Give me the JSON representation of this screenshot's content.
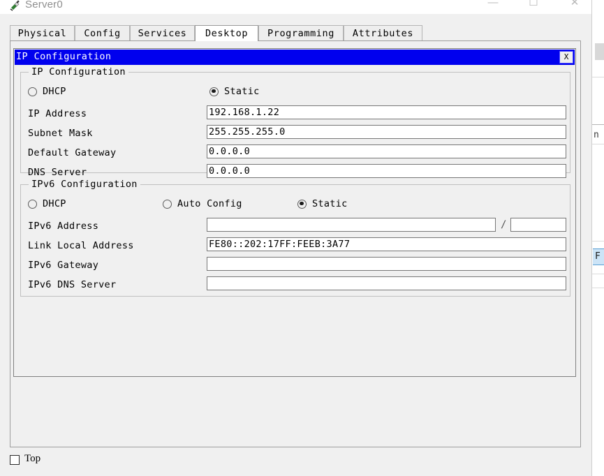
{
  "window": {
    "title": "Server0",
    "icon": "device-server-icon",
    "controls": {
      "minimize": "—",
      "maximize": "☐",
      "close": "✕"
    }
  },
  "tabs": [
    {
      "label": "Physical",
      "active": false
    },
    {
      "label": "Config",
      "active": false
    },
    {
      "label": "Services",
      "active": false
    },
    {
      "label": "Desktop",
      "active": true
    },
    {
      "label": "Programming",
      "active": false
    },
    {
      "label": "Attributes",
      "active": false
    }
  ],
  "dialog": {
    "title": "IP Configuration",
    "close_label": "X",
    "ipv4": {
      "legend": "IP Configuration",
      "mode_options": [
        {
          "label": "DHCP",
          "selected": false
        },
        {
          "label": "Static",
          "selected": true
        }
      ],
      "fields": [
        {
          "label": "IP Address",
          "value": "192.168.1.22"
        },
        {
          "label": "Subnet Mask",
          "value": "255.255.255.0"
        },
        {
          "label": "Default Gateway",
          "value": "0.0.0.0"
        },
        {
          "label": "DNS Server",
          "value": "0.0.0.0"
        }
      ]
    },
    "ipv6": {
      "legend": "IPv6 Configuration",
      "mode_options": [
        {
          "label": "DHCP",
          "selected": false
        },
        {
          "label": "Auto Config",
          "selected": false
        },
        {
          "label": "Static",
          "selected": true
        }
      ],
      "prefix_separator": "/",
      "prefix_value": "",
      "fields": [
        {
          "label": "IPv6 Address",
          "value": ""
        },
        {
          "label": "Link Local Address",
          "value": "FE80::202:17FF:FEEB:3A77"
        },
        {
          "label": "IPv6 Gateway",
          "value": ""
        },
        {
          "label": "IPv6 DNS Server",
          "value": ""
        }
      ]
    }
  },
  "bottom": {
    "top_checkbox_label": "Top",
    "top_checkbox_checked": false
  },
  "background_sliver": {
    "text_fragment": "n",
    "selected_fragment": "F"
  },
  "colors": {
    "dialog_titlebar": "#0000ee",
    "dialog_title_text": "#ffffff",
    "window_chrome": "#f0f0f0",
    "active_tab": "#ffffff",
    "inactive_tab": "#eeeeee",
    "field_background": "#ffffff",
    "field_border": "#767676",
    "selection_highlight": "#cce4f7"
  }
}
